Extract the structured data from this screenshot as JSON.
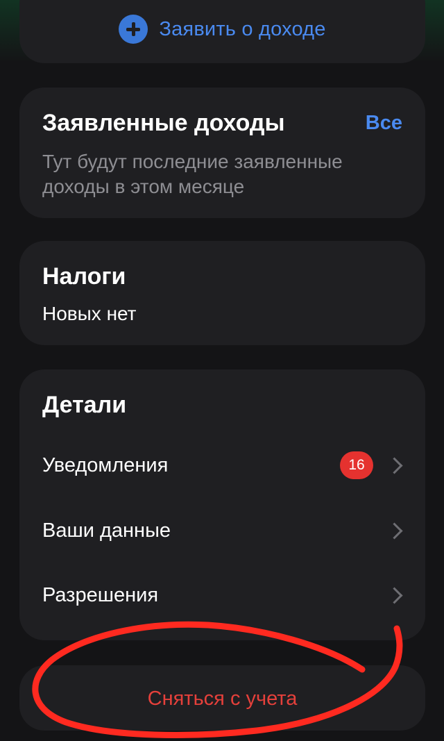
{
  "declare": {
    "label": "Заявить о доходе",
    "icon": "plus-circle-icon"
  },
  "declared": {
    "title": "Заявленные доходы",
    "all_link": "Все",
    "empty_text_line1": "Тут будут последние заявленные",
    "empty_text_line2": "доходы в этом месяце"
  },
  "taxes": {
    "title": "Налоги",
    "status": "Новых нет"
  },
  "details": {
    "title": "Детали",
    "items": [
      {
        "label": "Уведомления",
        "badge": "16",
        "icon": "chevron-right-icon"
      },
      {
        "label": "Ваши данные",
        "icon": "chevron-right-icon"
      },
      {
        "label": "Разрешения",
        "icon": "chevron-right-icon"
      }
    ]
  },
  "deregister": {
    "label": "Сняться с учета"
  },
  "colors": {
    "background": "#141416",
    "card": "#1f1f22",
    "accent_blue": "#4a8af0",
    "danger_red": "#e5403b",
    "badge_red": "#e5322f",
    "annotation_red": "#ff2a20"
  }
}
